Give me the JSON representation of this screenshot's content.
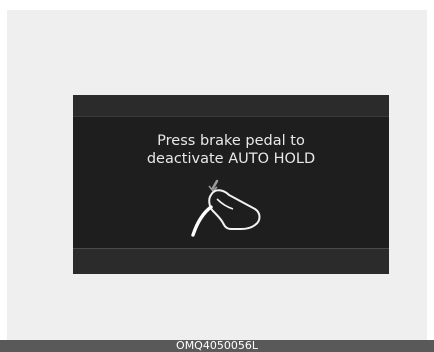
{
  "display": {
    "message_line1": "Press brake pedal to",
    "message_line2": "deactivate AUTO HOLD",
    "icon": "brake-pedal-foot-icon"
  },
  "caption": {
    "code": "OMQ4050056L"
  },
  "colors": {
    "screen_background": "#1e1e1e",
    "screen_text": "#e8e8e8",
    "page_background": "#efefef",
    "caption_background": "#595959"
  }
}
